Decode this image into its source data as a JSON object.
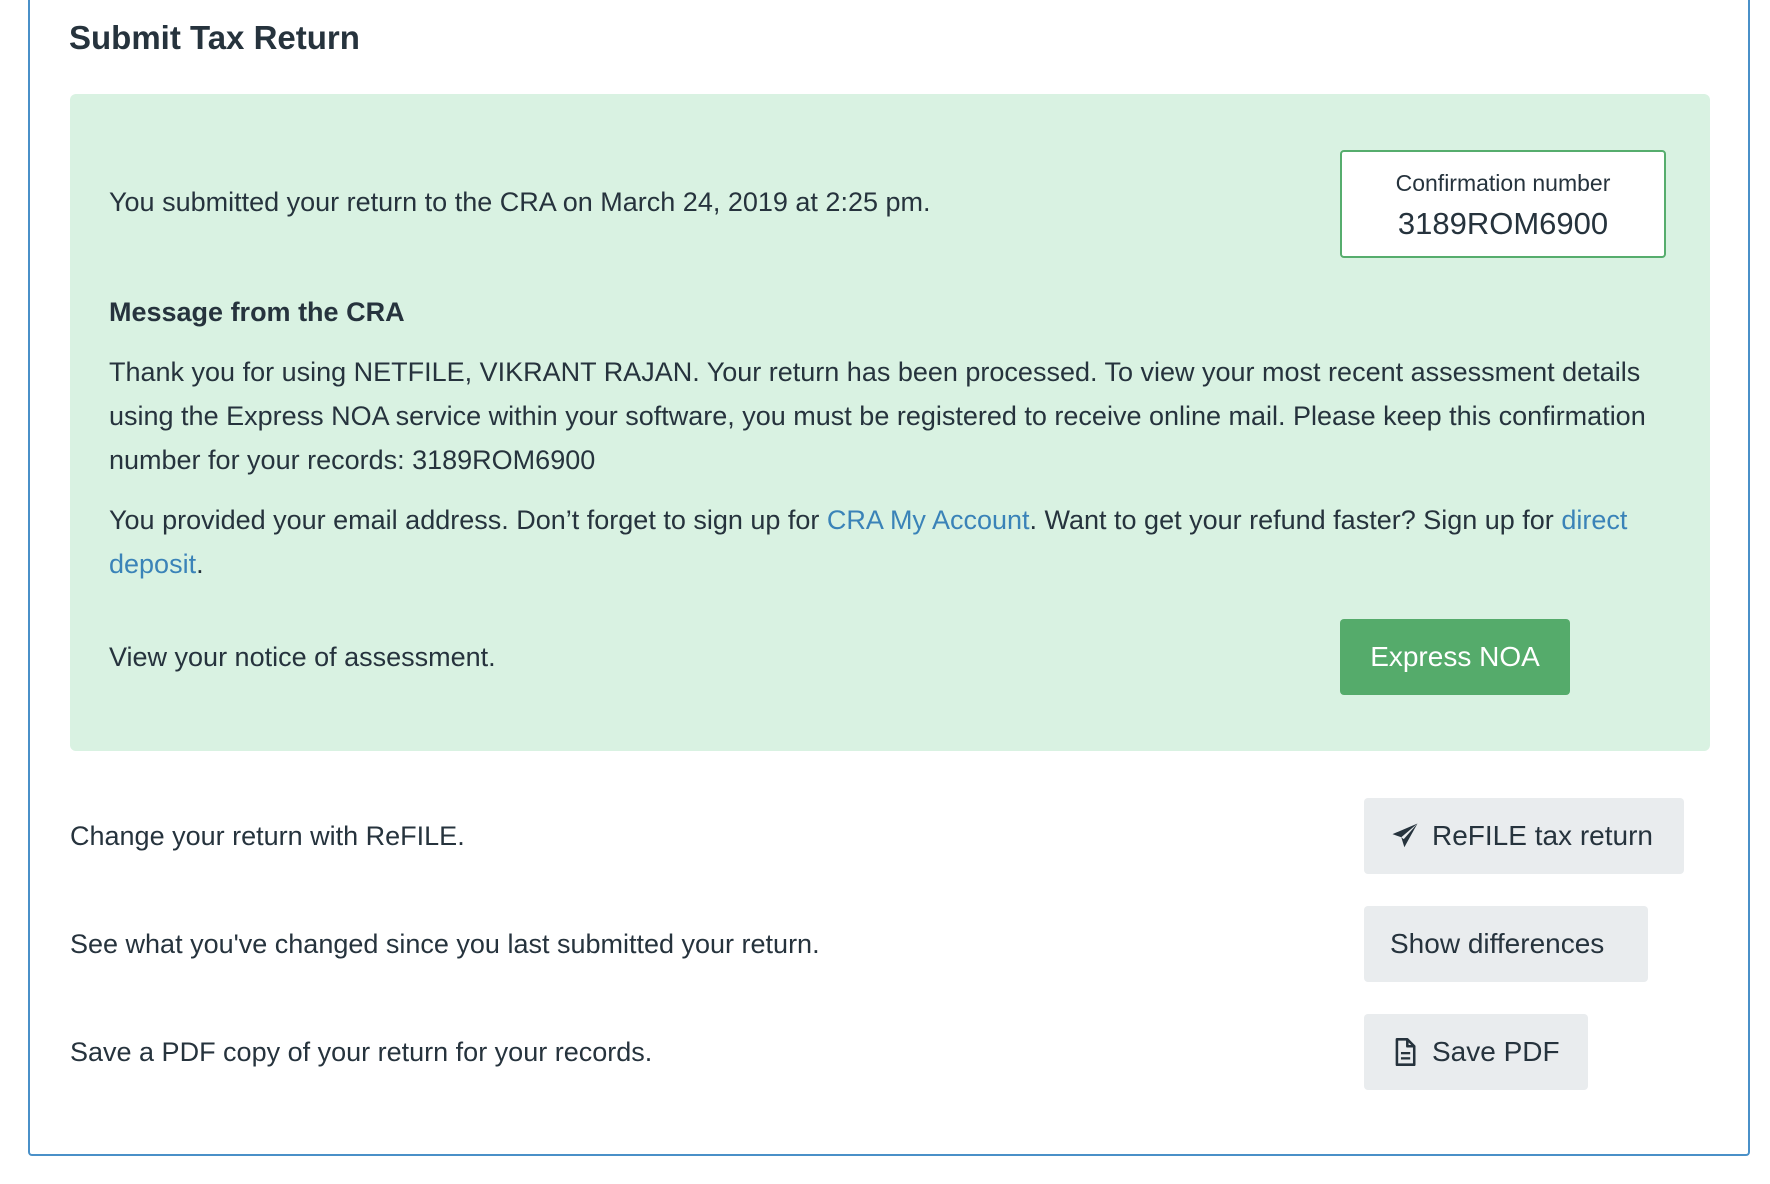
{
  "page": {
    "title": "Submit Tax Return"
  },
  "status": {
    "submitted_text": "You submitted your return to the CRA on March 24, 2019 at 2:25 pm.",
    "confirmation_label": "Confirmation number",
    "confirmation_number": "3189ROM6900",
    "message_heading": "Message from the CRA",
    "message_body": "Thank you for using NETFILE, VIKRANT RAJAN. Your return has been processed. To view your most recent assessment details using the Express NOA service within your software, you must be registered to receive online mail. Please keep this confirmation number for your records: 3189ROM6900",
    "email_text_1": "You provided your email address. Don’t forget to sign up for ",
    "my_account_link": "CRA My Account",
    "email_text_2": ". Want to get your refund faster? Sign up for ",
    "direct_deposit_link": "direct deposit",
    "email_text_3": ".",
    "noa_text": "View your notice of assessment.",
    "noa_button": "Express NOA"
  },
  "actions": {
    "refile_text": "Change your return with ReFILE.",
    "refile_button": "ReFILE tax return",
    "refile_icon": "paper-plane-icon",
    "diff_text": "See what you've changed since you last submitted your return.",
    "diff_button": "Show differences",
    "pdf_text": "Save a PDF copy of your return for your records.",
    "pdf_button": "Save PDF",
    "pdf_icon": "file-icon"
  },
  "colors": {
    "panel_bg": "#d9f2e2",
    "accent_green": "#55ab6b",
    "link_blue": "#3a83b8",
    "card_border": "#4a90c8",
    "button_gray": "#e9ecee"
  }
}
